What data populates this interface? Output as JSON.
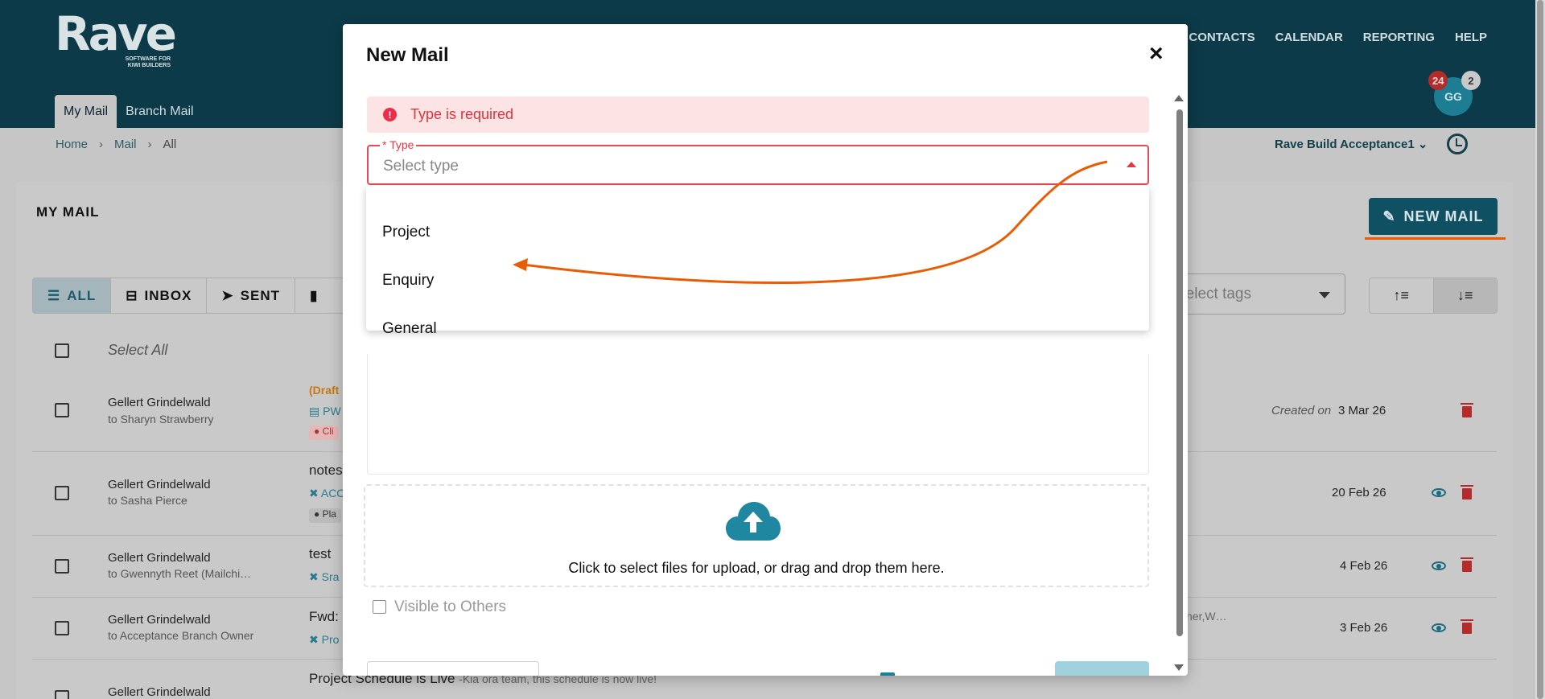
{
  "app": {
    "logo_text": "Rave",
    "logo_tagline": "SOFTWARE FOR KIWI BUILDERS",
    "nav": [
      "CONTACTS",
      "CALENDAR",
      "REPORTING",
      "HELP"
    ],
    "avatar_initials": "GG",
    "badge_red": "24",
    "badge_grey": "2",
    "subtabs": [
      "My Mail",
      "Branch Mail"
    ],
    "breadcrumb": [
      "Home",
      "Mail",
      "All"
    ],
    "branch": "Rave Build Acceptance1"
  },
  "mail": {
    "title": "MY MAIL",
    "new_mail_label": "NEW MAIL",
    "filters": [
      "ALL",
      "INBOX",
      "SENT"
    ],
    "tags_placeholder": "Select tags",
    "select_all": "Select All",
    "rows": [
      {
        "from": "Gellert Grindelwald",
        "to": "to Sharyn Strawberry",
        "draft": "(Draft",
        "meta": "PW",
        "tag": "Cli",
        "created_label": "Created on",
        "date": "3 Mar 26"
      },
      {
        "from": "Gellert Grindelwald",
        "to": "to Sasha Pierce",
        "subject": "notes",
        "meta": "ACC",
        "tag": "Pla",
        "date": "20 Feb 26"
      },
      {
        "from": "Gellert Grindelwald",
        "to": "to Gwennyth Reet (Mailchi…",
        "subject": "test",
        "meta": "Sra",
        "date": "4 Feb 26"
      },
      {
        "from": "Gellert Grindelwald",
        "to": "to Acceptance Branch Owner",
        "subject": "Fwd:",
        "meta": "Pro",
        "extra": "ner,W…",
        "date": "3 Feb 26"
      },
      {
        "from": "Gellert Grindelwald",
        "subject": "Project Schedule is Live",
        "preview": "-Kia ora team, this schedule is now live!"
      }
    ]
  },
  "modal": {
    "title": "New Mail",
    "close": "×",
    "alert": "Type is required",
    "alert_icon": "!",
    "type_label": "* Type",
    "type_placeholder": "Select type",
    "options": [
      "Project",
      "Enquiry",
      "General"
    ],
    "upload_text": "Click to select files for upload, or drag and drop them here.",
    "visible_label": "Visible to Others"
  },
  "colors": {
    "header": "#0c3a48",
    "accent": "#0f5062",
    "error": "#e53845",
    "annotation": "#e85d04"
  }
}
